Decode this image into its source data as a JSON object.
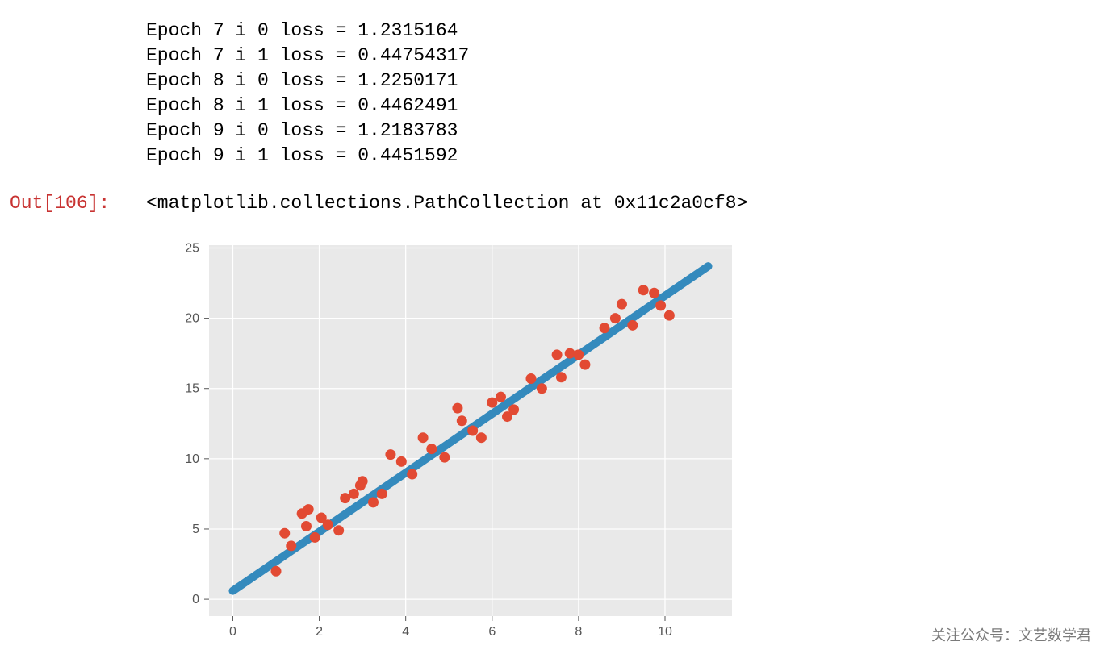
{
  "log_lines": [
    "Epoch 7 i 0 loss = 1.2315164",
    "Epoch 7 i 1 loss = 0.44754317",
    "Epoch 8 i 0 loss = 1.2250171",
    "Epoch 8 i 1 loss = 0.4462491",
    "Epoch 9 i 0 loss = 1.2183783",
    "Epoch 9 i 1 loss = 0.4451592"
  ],
  "out_label": "Out[106]:",
  "out_text": "<matplotlib.collections.PathCollection at 0x11c2a0cf8>",
  "watermark": "关注公众号：文艺数学君",
  "chart_data": {
    "type": "scatter",
    "xlim": [
      -0.55,
      11.55
    ],
    "ylim": [
      -1.2,
      25.2
    ],
    "x_ticks": [
      0,
      2,
      4,
      6,
      8,
      10
    ],
    "y_ticks": [
      0,
      5,
      10,
      15,
      20,
      25
    ],
    "grid": true,
    "series": [
      {
        "name": "fit_line",
        "type": "line",
        "x": [
          0,
          11
        ],
        "y": [
          0.6,
          23.7
        ],
        "color": "#348abd"
      },
      {
        "name": "data_points",
        "type": "scatter",
        "color": "#e24a33",
        "points": [
          {
            "x": 1.0,
            "y": 2.0
          },
          {
            "x": 1.2,
            "y": 4.7
          },
          {
            "x": 1.35,
            "y": 3.8
          },
          {
            "x": 1.6,
            "y": 6.1
          },
          {
            "x": 1.7,
            "y": 5.2
          },
          {
            "x": 1.75,
            "y": 6.4
          },
          {
            "x": 1.9,
            "y": 4.4
          },
          {
            "x": 2.05,
            "y": 5.8
          },
          {
            "x": 2.2,
            "y": 5.3
          },
          {
            "x": 2.45,
            "y": 4.9
          },
          {
            "x": 2.6,
            "y": 7.2
          },
          {
            "x": 2.8,
            "y": 7.5
          },
          {
            "x": 2.95,
            "y": 8.1
          },
          {
            "x": 3.0,
            "y": 8.4
          },
          {
            "x": 3.25,
            "y": 6.9
          },
          {
            "x": 3.45,
            "y": 7.5
          },
          {
            "x": 3.65,
            "y": 10.3
          },
          {
            "x": 3.9,
            "y": 9.8
          },
          {
            "x": 4.15,
            "y": 8.9
          },
          {
            "x": 4.4,
            "y": 11.5
          },
          {
            "x": 4.6,
            "y": 10.7
          },
          {
            "x": 4.9,
            "y": 10.1
          },
          {
            "x": 5.2,
            "y": 13.6
          },
          {
            "x": 5.3,
            "y": 12.7
          },
          {
            "x": 5.55,
            "y": 12.0
          },
          {
            "x": 5.75,
            "y": 11.5
          },
          {
            "x": 6.0,
            "y": 14.0
          },
          {
            "x": 6.2,
            "y": 14.4
          },
          {
            "x": 6.35,
            "y": 13.0
          },
          {
            "x": 6.5,
            "y": 13.5
          },
          {
            "x": 6.9,
            "y": 15.7
          },
          {
            "x": 7.15,
            "y": 15.0
          },
          {
            "x": 7.5,
            "y": 17.4
          },
          {
            "x": 7.6,
            "y": 15.8
          },
          {
            "x": 7.8,
            "y": 17.5
          },
          {
            "x": 8.0,
            "y": 17.4
          },
          {
            "x": 8.15,
            "y": 16.7
          },
          {
            "x": 8.6,
            "y": 19.3
          },
          {
            "x": 8.85,
            "y": 20.0
          },
          {
            "x": 9.0,
            "y": 21.0
          },
          {
            "x": 9.25,
            "y": 19.5
          },
          {
            "x": 9.5,
            "y": 22.0
          },
          {
            "x": 9.75,
            "y": 21.8
          },
          {
            "x": 9.9,
            "y": 20.9
          },
          {
            "x": 10.1,
            "y": 20.2
          }
        ]
      }
    ]
  }
}
